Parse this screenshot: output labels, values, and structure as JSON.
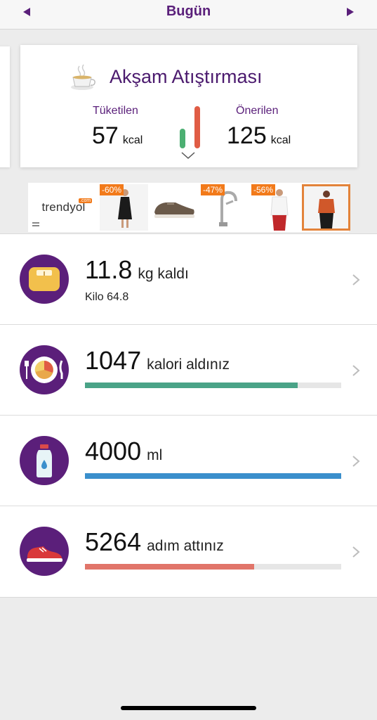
{
  "header": {
    "title": "Bugün",
    "prev_icon": "triangle-left-icon",
    "next_icon": "triangle-right-icon"
  },
  "meal": {
    "title": "Akşam Atıştırması",
    "icon": "tea-cup-icon",
    "consumed_label": "Tüketilen",
    "consumed_value": "57",
    "suggested_label": "Önerilen",
    "suggested_value": "125",
    "unit": "kcal",
    "consumed_ratio": 0.456
  },
  "ads": {
    "logo_text": "trendyol",
    "logo_suffix": ".com",
    "items": [
      {
        "badge": "-60%",
        "subject": "black-dress"
      },
      {
        "badge": "",
        "subject": "brown-sneaker"
      },
      {
        "badge": "-47%",
        "subject": "kitchen-faucet"
      },
      {
        "badge": "-56%",
        "subject": "white-shirt-red-pants"
      },
      {
        "badge": "",
        "subject": "orange-blouse",
        "selected": true
      }
    ]
  },
  "metrics": [
    {
      "icon": "scale-icon",
      "value": "11.8",
      "suffix": "kg kaldı",
      "sub": "Kilo 64.8"
    },
    {
      "icon": "plate-icon",
      "value": "1047",
      "suffix": "kalori aldınız",
      "progress": 0.83,
      "color": "#4aa387"
    },
    {
      "icon": "water-bottle-icon",
      "value": "4000",
      "suffix": "ml",
      "progress": 1.0,
      "color": "#3a8fcc"
    },
    {
      "icon": "sneaker-icon",
      "value": "5264",
      "suffix": "adım attınız",
      "progress": 0.66,
      "color": "#e1756a"
    }
  ],
  "colors": {
    "brand_purple": "#5a1f7a",
    "accent_orange": "#f27a1a"
  }
}
